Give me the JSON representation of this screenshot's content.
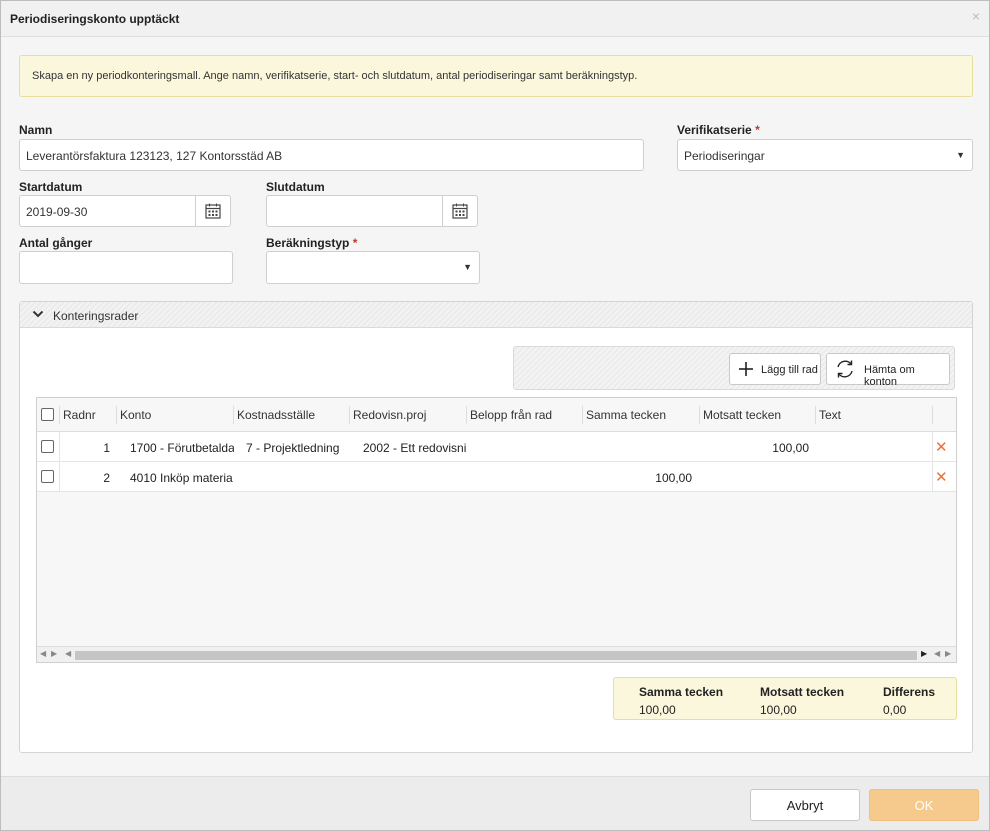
{
  "dialog": {
    "title": "Periodiseringskonto upptäckt",
    "close_label": "×"
  },
  "info": {
    "text": "Skapa en ny periodkonteringsmall. Ange namn, verifikatserie, start- och slutdatum, antal periodiseringar samt beräkningstyp."
  },
  "form": {
    "namn_label": "Namn",
    "namn_value": "Leverantörsfaktura 123123, 127 Kontorsstäd AB",
    "verifikatserie_label": "Verifikatserie",
    "verifikatserie_value": "Periodiseringar",
    "required_mark": "*",
    "startdatum_label": "Startdatum",
    "startdatum_value": "2019-09-30",
    "slutdatum_label": "Slutdatum",
    "slutdatum_value": "",
    "antal_label": "Antal gånger",
    "antal_value": "",
    "berakningstyp_label": "Beräkningstyp",
    "berakningstyp_value": ""
  },
  "panel": {
    "title": "Konteringsrader",
    "toolbar": {
      "add_row_label": "Lägg till rad",
      "refresh_label": "Hämta om konton"
    }
  },
  "grid": {
    "columns": [
      "Radnr",
      "Konto",
      "Kostnadsställe",
      "Redovisn.proj",
      "Belopp från rad",
      "Samma tecken",
      "Motsatt tecken",
      "Text"
    ],
    "rows": [
      {
        "radnr": "1",
        "konto": "1700 - Förutbetalda",
        "kostnadsstalle": "7 - Projektledning",
        "redovisn": "2002 - Ett redovisni",
        "belopp": "",
        "samma": "",
        "motsatt": "100,00",
        "text": ""
      },
      {
        "radnr": "2",
        "konto": "4010 Inköp materia",
        "kostnadsstalle": "",
        "redovisn": "",
        "belopp": "",
        "samma": "100,00",
        "motsatt": "",
        "text": ""
      }
    ]
  },
  "totals": {
    "samma_label": "Samma tecken",
    "samma_value": "100,00",
    "motsatt_label": "Motsatt tecken",
    "motsatt_value": "100,00",
    "differens_label": "Differens",
    "differens_value": "0,00"
  },
  "footer": {
    "cancel_label": "Avbryt",
    "ok_label": "OK"
  },
  "colors": {
    "ok_bg": "#f6c98d",
    "delete": "#e8703a",
    "info_bg": "#fbf7dc"
  }
}
